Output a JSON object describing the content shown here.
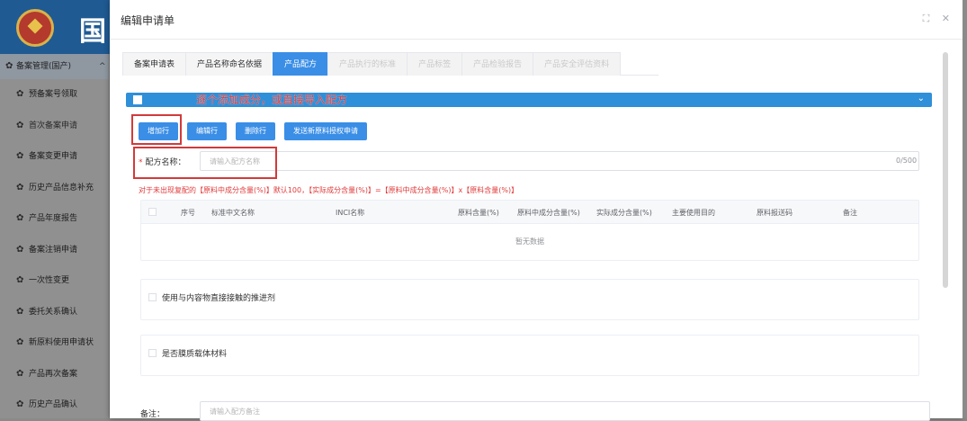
{
  "background": {
    "site_title_char": "国",
    "sidebar_group": "备案管理(国产)",
    "sidebar_items": [
      "预备案号领取",
      "首次备案申请",
      "备案变更申请",
      "历史产品信息补充",
      "产品年度报告",
      "备案注销申请",
      "一次性变更",
      "委托关系确认",
      "新原料使用申请状",
      "产品再次备案",
      "历史产品确认"
    ]
  },
  "modal": {
    "title": "编辑申请单",
    "tabs": [
      {
        "label": "备案申请表",
        "state": "normal"
      },
      {
        "label": "产品名称命名依据",
        "state": "normal"
      },
      {
        "label": "产品配方",
        "state": "active"
      },
      {
        "label": "产品执行的标准",
        "state": "disabled"
      },
      {
        "label": "产品标签",
        "state": "disabled"
      },
      {
        "label": "产品检验报告",
        "state": "disabled"
      },
      {
        "label": "产品安全评估资料",
        "state": "disabled"
      }
    ],
    "annotation": "逐个添加成分，或直接导入配方",
    "buttons": {
      "add_row": "增加行",
      "edit_row": "编辑行",
      "delete_row": "删除行",
      "send_authorization": "发送新原料授权申请"
    },
    "formula_name": {
      "label": "配方名称：",
      "placeholder": "请输入配方名称",
      "counter": "0/500"
    },
    "note": "对于未出现复配的【原料中成分含量(%)】默认100，【实际成分含量(%)】=【原料中成分含量(%)】x【原料含量(%)】",
    "table": {
      "columns": [
        "序号",
        "标准中文名称",
        "INCI名称",
        "原料含量(%)",
        "原料中成分含量(%)",
        "实际成分含量(%)",
        "主要使用目的",
        "原料报送码",
        "备注"
      ],
      "empty_text": "暂无数据"
    },
    "option1": "使用与内容物直接接触的推进剂",
    "option2": "是否膜质载体材料",
    "remark": {
      "label": "备注：",
      "placeholder": "请输入配方备注"
    }
  },
  "colors": {
    "primary": "#3a8ee6",
    "annotation_red": "#d23a3a"
  }
}
